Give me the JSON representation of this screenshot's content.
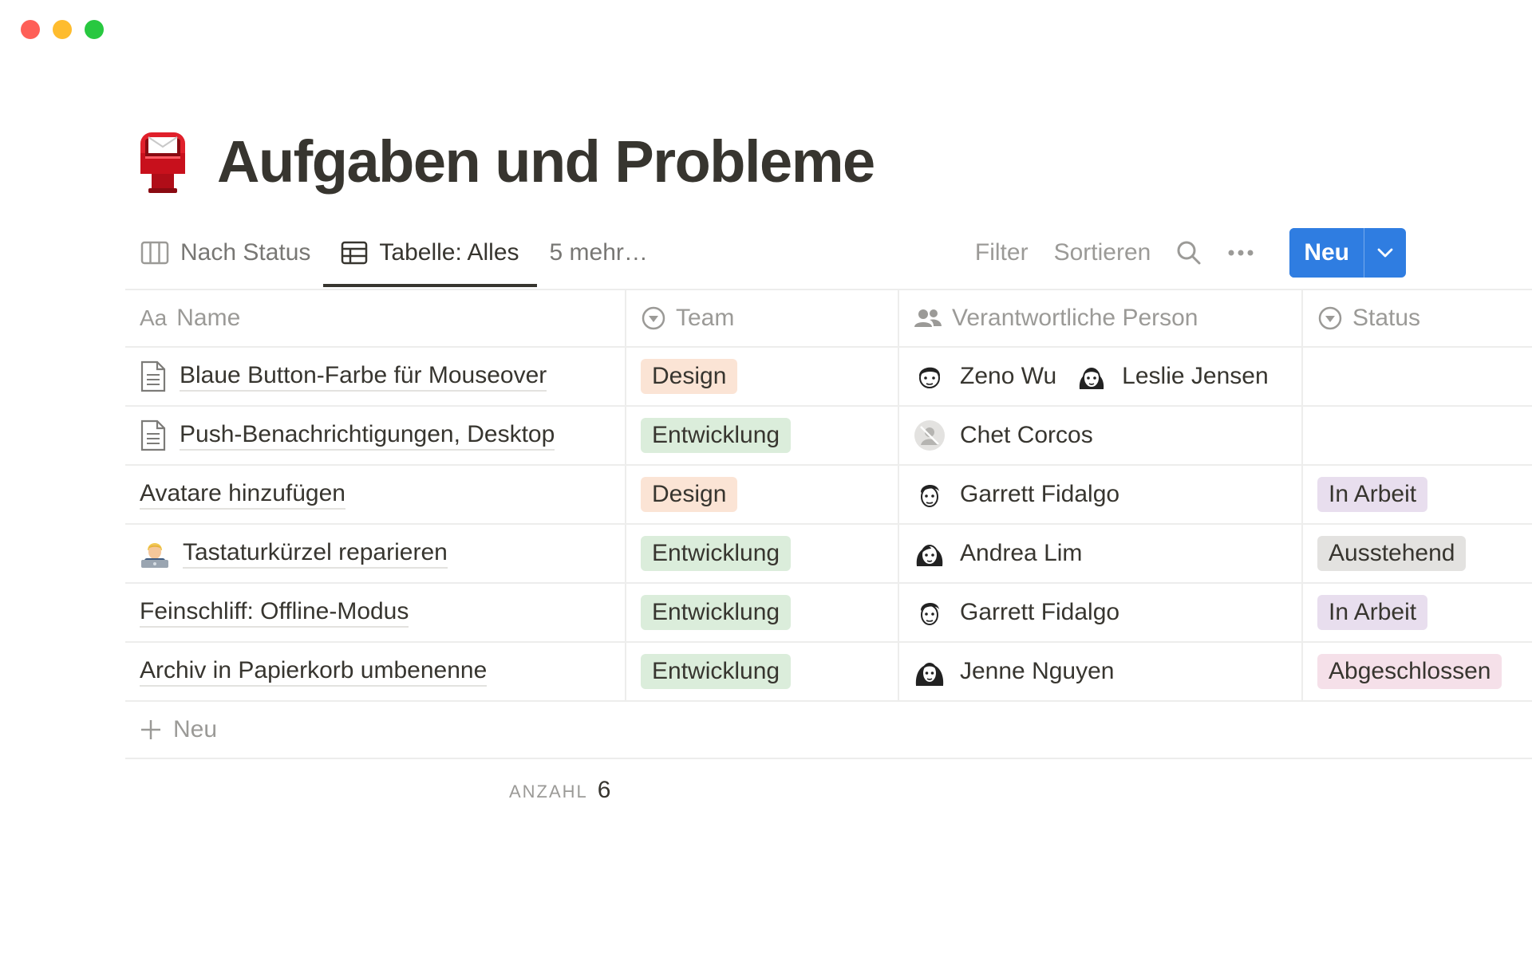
{
  "window": {
    "traffic_lights": [
      "close",
      "minimize",
      "zoom"
    ]
  },
  "page": {
    "icon": "postbox-icon",
    "title": "Aufgaben und Probleme"
  },
  "tabs": [
    {
      "label": "Nach Status",
      "icon": "board-icon",
      "active": false
    },
    {
      "label": "Tabelle: Alles",
      "icon": "table-icon",
      "active": true
    },
    {
      "label": "5 mehr…",
      "active": false
    }
  ],
  "toolbar": {
    "filter_label": "Filter",
    "sort_label": "Sortieren",
    "search_icon": "search-icon",
    "more_icon": "more-icon",
    "new_label": "Neu"
  },
  "columns": {
    "name": {
      "prefix": "Aa",
      "label": "Name"
    },
    "team": {
      "label": "Team",
      "icon": "select-icon"
    },
    "person": {
      "label": "Verantwortliche Person",
      "icon": "people-icon"
    },
    "status": {
      "label": "Status",
      "icon": "select-icon"
    }
  },
  "colors": {
    "design_bg": "#fbe4d5",
    "design_fg": "#37352f",
    "entwicklung_bg": "#dbeddb",
    "entwicklung_fg": "#37352f",
    "in_arbeit_bg": "#e8deee",
    "ausstehend_bg": "#e3e2e0",
    "abgeschlossen_bg": "#f5e0e9",
    "accent": "#2f7de1"
  },
  "rows": [
    {
      "name": "Blaue Button-Farbe für Mouseover",
      "icon": "document-icon",
      "team": "Design",
      "persons": [
        "Zeno Wu",
        "Leslie Jensen"
      ],
      "status": ""
    },
    {
      "name": "Push-Benachrichtigungen, Desktop",
      "icon": "document-icon",
      "team": "Entwicklung",
      "persons": [
        "Chet Corcos"
      ],
      "status": ""
    },
    {
      "name": "Avatare hinzufügen",
      "icon": "",
      "team": "Design",
      "persons": [
        "Garrett Fidalgo"
      ],
      "status": "In Arbeit"
    },
    {
      "name": "Tastaturkürzel reparieren",
      "icon": "technologist-emoji-icon",
      "team": "Entwicklung",
      "persons": [
        "Andrea Lim"
      ],
      "status": "Ausstehend"
    },
    {
      "name": "Feinschliff: Offline-Modus",
      "icon": "",
      "team": "Entwicklung",
      "persons": [
        "Garrett Fidalgo"
      ],
      "status": "In Arbeit"
    },
    {
      "name": "Archiv in Papierkorb umbenenne",
      "icon": "",
      "team": "Entwicklung",
      "persons": [
        "Jenne Nguyen"
      ],
      "status": "Abgeschlossen"
    }
  ],
  "add_row_label": "Neu",
  "footer": {
    "count_label": "ANZAHL",
    "count_value": "6"
  }
}
